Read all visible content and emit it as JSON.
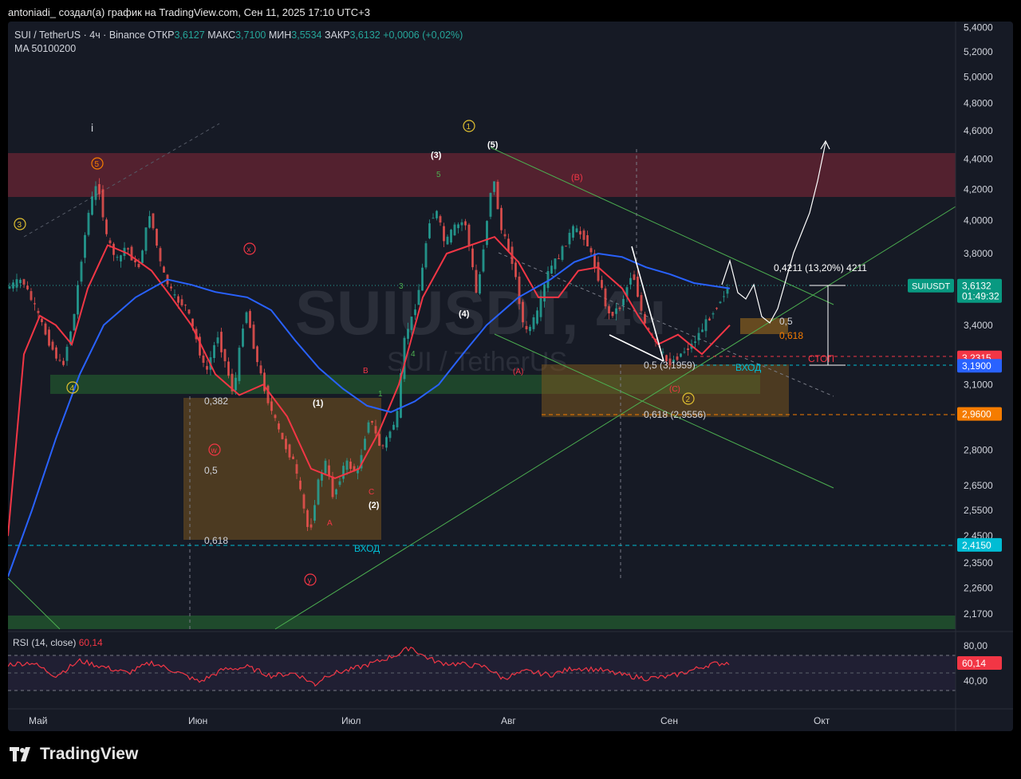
{
  "top_title": "antoniadi_ создал(а) график на TradingView.com, Сен 11, 2025 17:10 UTC+3",
  "legend": {
    "symbol": "SUI / TetherUS · 4ч · Binance",
    "open_label": "ОТКР",
    "open": "3,6127",
    "high_label": "МАКС",
    "high": "3,7100",
    "low_label": "МИН",
    "low": "3,5534",
    "close_label": "ЗАКР",
    "close": "3,6132",
    "change": "+0,0006 (+0,02%)",
    "ma": "MA 50100200"
  },
  "watermark": {
    "symbol": "SUIUSDT, 4ч",
    "name": "SUI / TetherUS"
  },
  "rsi": {
    "label": "RSI (14, close)",
    "value": "60,14"
  },
  "logo": "TradingView",
  "colors": {
    "up": "#26a69a",
    "down": "#ef5350",
    "ma_red": "#f23645",
    "ma_blue": "#2962ff",
    "bg": "#161a25",
    "rsi": "#f23645"
  },
  "chart_data": {
    "type": "line",
    "symbol": "SUIUSDT",
    "log_scale": true,
    "ylim": [
      2.12,
      5.45
    ],
    "y_ticks": [
      "5,4000",
      "5,2000",
      "5,0000",
      "4,8000",
      "4,6000",
      "4,4000",
      "4,2000",
      "4,0000",
      "3,8000",
      "3,4000",
      "3,1000",
      "2,8000",
      "2,6500",
      "2,5500",
      "2,4500",
      "2,3500",
      "2,2600",
      "2,1700"
    ],
    "x_ticks": [
      "Май",
      "Июн",
      "Июл",
      "Авг",
      "Сен",
      "Окт"
    ],
    "price_badges": [
      {
        "label": "SUIUSDT",
        "value": "3,6132",
        "time": "01:49:32",
        "color": "#089981"
      },
      {
        "value": "3,2315",
        "color": "#f23645"
      },
      {
        "value": "3,1900",
        "color": "#2962ff"
      },
      {
        "value": "2,9600",
        "color": "#f57c00"
      },
      {
        "value": "2,4150",
        "color": "#00bcd4"
      }
    ],
    "series": [
      {
        "name": "",
        "points": [
          [
            0,
            3.6
          ],
          [
            20,
            3.65
          ],
          [
            40,
            3.45
          ],
          [
            55,
            3.3
          ],
          [
            70,
            3.18
          ],
          [
            85,
            3.45
          ],
          [
            95,
            3.8
          ],
          [
            105,
            4.1
          ],
          [
            115,
            4.25
          ],
          [
            125,
            3.9
          ],
          [
            140,
            3.75
          ],
          [
            150,
            3.85
          ],
          [
            165,
            3.7
          ],
          [
            180,
            4.05
          ],
          [
            195,
            3.7
          ],
          [
            210,
            3.55
          ],
          [
            225,
            3.5
          ],
          [
            240,
            3.3
          ],
          [
            250,
            3.15
          ],
          [
            265,
            3.35
          ],
          [
            285,
            3.05
          ],
          [
            300,
            3.5
          ],
          [
            315,
            3.2
          ],
          [
            330,
            3.0
          ],
          [
            345,
            2.85
          ],
          [
            360,
            2.75
          ],
          [
            370,
            2.6
          ],
          [
            380,
            2.45
          ],
          [
            390,
            2.65
          ],
          [
            400,
            2.75
          ],
          [
            410,
            2.6
          ],
          [
            425,
            2.75
          ],
          [
            440,
            2.7
          ],
          [
            455,
            2.95
          ],
          [
            470,
            2.8
          ],
          [
            490,
            2.95
          ],
          [
            500,
            3.35
          ],
          [
            510,
            3.45
          ],
          [
            520,
            3.65
          ],
          [
            530,
            4.0
          ],
          [
            540,
            4.05
          ],
          [
            550,
            3.85
          ],
          [
            560,
            3.95
          ],
          [
            575,
            4.0
          ],
          [
            590,
            3.55
          ],
          [
            600,
            3.9
          ],
          [
            610,
            4.3
          ],
          [
            620,
            3.95
          ],
          [
            635,
            3.75
          ],
          [
            650,
            3.35
          ],
          [
            665,
            3.45
          ],
          [
            680,
            3.7
          ],
          [
            695,
            3.8
          ],
          [
            710,
            3.95
          ],
          [
            725,
            3.9
          ],
          [
            740,
            3.7
          ],
          [
            755,
            3.45
          ],
          [
            770,
            3.5
          ],
          [
            785,
            3.7
          ],
          [
            800,
            3.4
          ],
          [
            815,
            3.3
          ],
          [
            830,
            3.2
          ],
          [
            845,
            3.25
          ],
          [
            860,
            3.3
          ],
          [
            875,
            3.4
          ],
          [
            890,
            3.5
          ],
          [
            905,
            3.61
          ]
        ]
      },
      {
        "name": "",
        "points": [
          [
            0,
            2.45
          ],
          [
            20,
            3.25
          ],
          [
            40,
            3.45
          ],
          [
            60,
            3.4
          ],
          [
            80,
            3.3
          ],
          [
            100,
            3.6
          ],
          [
            125,
            3.85
          ],
          [
            150,
            3.8
          ],
          [
            180,
            3.7
          ],
          [
            205,
            3.55
          ],
          [
            230,
            3.4
          ],
          [
            260,
            3.15
          ],
          [
            290,
            3.05
          ],
          [
            320,
            3.1
          ],
          [
            350,
            2.95
          ],
          [
            380,
            2.72
          ],
          [
            410,
            2.68
          ],
          [
            440,
            2.72
          ],
          [
            465,
            2.88
          ],
          [
            490,
            3.1
          ],
          [
            520,
            3.55
          ],
          [
            550,
            3.8
          ],
          [
            580,
            3.85
          ],
          [
            610,
            3.9
          ],
          [
            640,
            3.75
          ],
          [
            665,
            3.55
          ],
          [
            690,
            3.55
          ],
          [
            715,
            3.7
          ],
          [
            740,
            3.72
          ],
          [
            770,
            3.6
          ],
          [
            790,
            3.45
          ],
          [
            815,
            3.3
          ],
          [
            840,
            3.35
          ],
          [
            870,
            3.25
          ],
          [
            905,
            3.4
          ]
        ]
      },
      {
        "name": "",
        "points": [
          [
            0,
            2.3
          ],
          [
            30,
            2.55
          ],
          [
            60,
            2.85
          ],
          [
            90,
            3.15
          ],
          [
            120,
            3.4
          ],
          [
            160,
            3.55
          ],
          [
            200,
            3.65
          ],
          [
            230,
            3.62
          ],
          [
            260,
            3.58
          ],
          [
            300,
            3.55
          ],
          [
            330,
            3.48
          ],
          [
            360,
            3.32
          ],
          [
            390,
            3.18
          ],
          [
            420,
            3.08
          ],
          [
            450,
            3.0
          ],
          [
            480,
            2.97
          ],
          [
            510,
            3.02
          ],
          [
            540,
            3.1
          ],
          [
            570,
            3.25
          ],
          [
            600,
            3.4
          ],
          [
            640,
            3.55
          ],
          [
            680,
            3.65
          ],
          [
            710,
            3.75
          ],
          [
            740,
            3.8
          ],
          [
            770,
            3.78
          ],
          [
            800,
            3.72
          ],
          [
            830,
            3.68
          ],
          [
            860,
            3.63
          ],
          [
            905,
            3.6
          ]
        ]
      },
      {
        "name": "",
        "points": [
          [
            0,
            58
          ],
          [
            30,
            60
          ],
          [
            60,
            45
          ],
          [
            90,
            62
          ],
          [
            120,
            55
          ],
          [
            150,
            48
          ],
          [
            180,
            60
          ],
          [
            210,
            50
          ],
          [
            240,
            38
          ],
          [
            270,
            52
          ],
          [
            300,
            55
          ],
          [
            330,
            45
          ],
          [
            360,
            48
          ],
          [
            385,
            35
          ],
          [
            400,
            46
          ],
          [
            430,
            52
          ],
          [
            460,
            60
          ],
          [
            490,
            70
          ],
          [
            505,
            78
          ],
          [
            520,
            68
          ],
          [
            540,
            60
          ],
          [
            570,
            58
          ],
          [
            600,
            55
          ],
          [
            620,
            42
          ],
          [
            650,
            50
          ],
          [
            680,
            46
          ],
          [
            710,
            54
          ],
          [
            740,
            52
          ],
          [
            770,
            46
          ],
          [
            800,
            42
          ],
          [
            830,
            44
          ],
          [
            860,
            52
          ],
          [
            880,
            58
          ],
          [
            905,
            60
          ]
        ]
      }
    ],
    "annotations": [
      "(3)",
      "(5)",
      "5",
      "(B)",
      "3",
      "4",
      "(4)",
      "(A)",
      "B",
      "1",
      "(1)",
      "C",
      "(2)",
      "A",
      "0,382",
      "0,5",
      "0,618",
      "ВХОД",
      "0,5",
      "0,618",
      "0,5 (3,1959)",
      "0,618 (2,9556)",
      "(C)",
      "0,4211 (13,20%) 4211",
      "СТОП",
      "ВХОД"
    ]
  }
}
